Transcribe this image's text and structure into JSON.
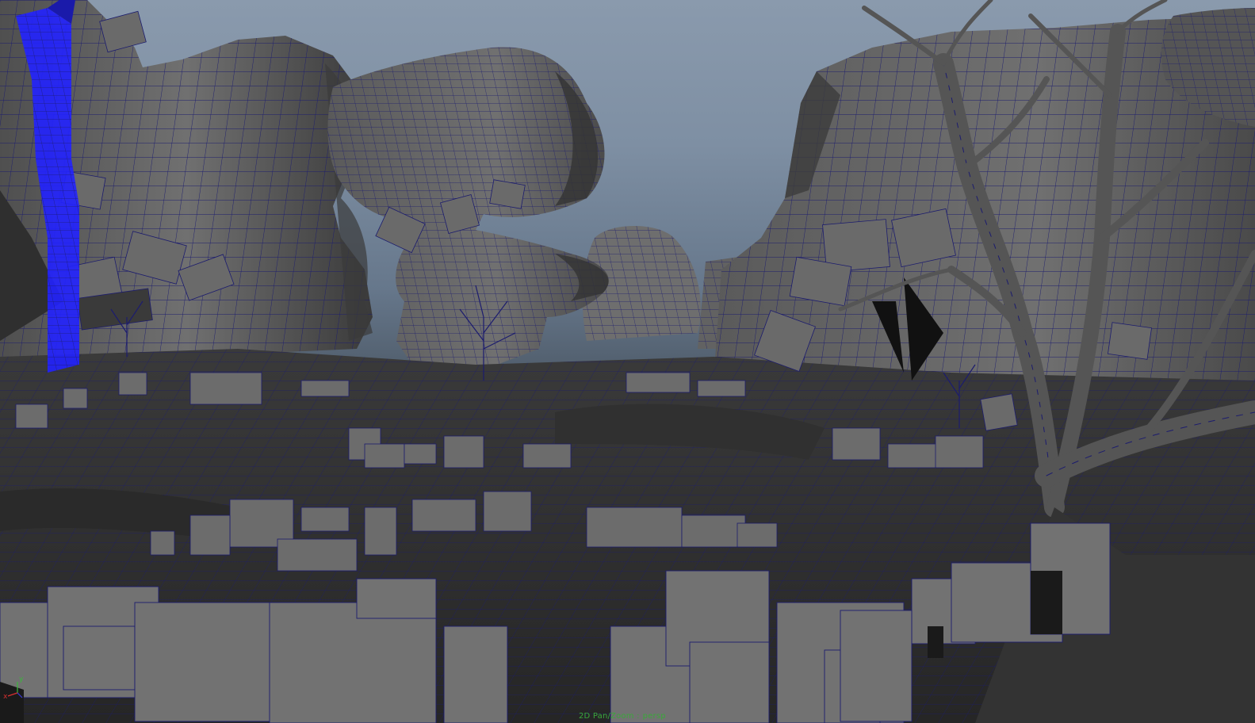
{
  "viewport": {
    "status_operation": "2D Pan/Zoom :",
    "status_camera": "persp"
  },
  "axis_gizmo": {
    "x_label": "x",
    "y_label": "y",
    "x_color": "#d93030",
    "y_color": "#3ab83a"
  },
  "scene": {
    "mesh_color": "#6a6a6a",
    "wire_color": "#1a1a7a",
    "selected_wire_color": "#2222ff",
    "shadow_color": "#222222",
    "sky_top": "#8a9aad",
    "sky_bottom": "#7e8fa3"
  }
}
